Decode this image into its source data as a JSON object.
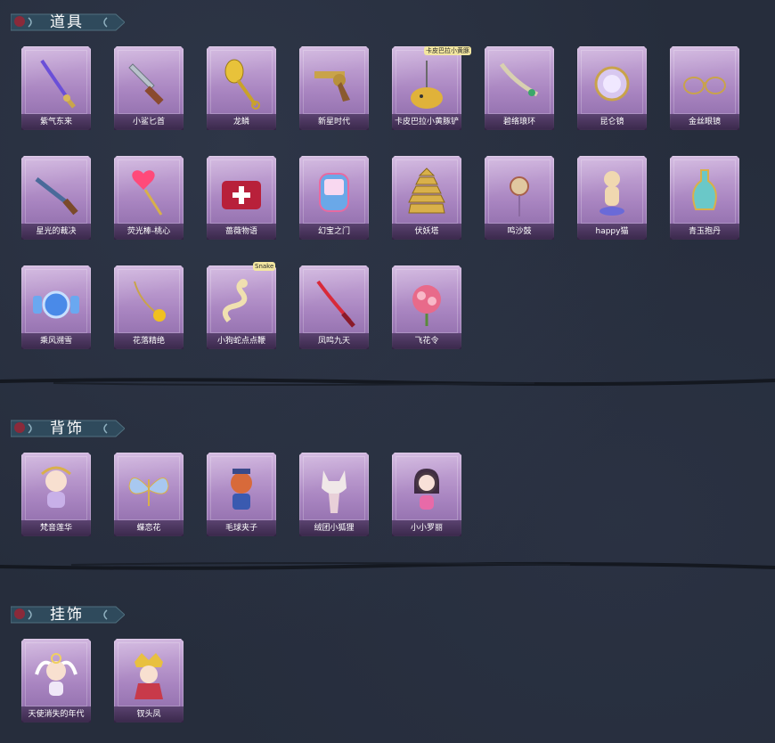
{
  "colors": {
    "background": "#262d3c",
    "card_top": "#cdb0dc",
    "card_bottom": "#8a68a6",
    "banner": "#2f4a5c"
  },
  "sections": [
    {
      "title": "道具",
      "items": [
        {
          "name": "紫气东来",
          "icon": "sword-icon"
        },
        {
          "name": "小鲨匕首",
          "icon": "dagger-icon"
        },
        {
          "name": "龙鳞",
          "icon": "golden-shovel-icon"
        },
        {
          "name": "新星时代",
          "icon": "revolver-icon"
        },
        {
          "name": "卡皮巴拉小黄豚铲",
          "icon": "capybara-shovel-icon",
          "tag": "卡皮巴拉小黄豚"
        },
        {
          "name": "碧络琅环",
          "icon": "jade-blade-icon"
        },
        {
          "name": "昆仑镜",
          "icon": "mirror-icon"
        },
        {
          "name": "金丝眼镜",
          "icon": "glasses-icon"
        },
        {
          "name": "星光的裁决",
          "icon": "shotgun-icon"
        },
        {
          "name": "荧光棒-桃心",
          "icon": "heart-wand-icon"
        },
        {
          "name": "蔷薇物语",
          "icon": "medkit-icon"
        },
        {
          "name": "幻宝之门",
          "icon": "device-icon"
        },
        {
          "name": "伏妖塔",
          "icon": "pagoda-icon"
        },
        {
          "name": "鸣沙鼓",
          "icon": "drum-icon"
        },
        {
          "name": "happy猫",
          "icon": "cat-icon"
        },
        {
          "name": "青玉抱丹",
          "icon": "vase-icon"
        },
        {
          "name": "乘风溯雪",
          "icon": "blue-gear-icon"
        },
        {
          "name": "花落精绝",
          "icon": "flower-chain-icon"
        },
        {
          "name": "小狗蛇点点鞭",
          "icon": "snake-whip-icon",
          "tag": "Snake"
        },
        {
          "name": "凤鸣九天",
          "icon": "red-blade-icon"
        },
        {
          "name": "飞花令",
          "icon": "bouquet-icon"
        }
      ]
    },
    {
      "title": "背饰",
      "items": [
        {
          "name": "梵音莲华",
          "icon": "lotus-doll-icon"
        },
        {
          "name": "蝶恋花",
          "icon": "butterfly-icon"
        },
        {
          "name": "毛球夹子",
          "icon": "raccoon-icon"
        },
        {
          "name": "绒团小狐狸",
          "icon": "fox-icon"
        },
        {
          "name": "小小罗丽",
          "icon": "doll-icon"
        }
      ]
    },
    {
      "title": "挂饰",
      "items": [
        {
          "name": "天使消失的年代",
          "icon": "angel-doll-icon"
        },
        {
          "name": "钗头凤",
          "icon": "phoenix-doll-icon"
        }
      ]
    }
  ]
}
